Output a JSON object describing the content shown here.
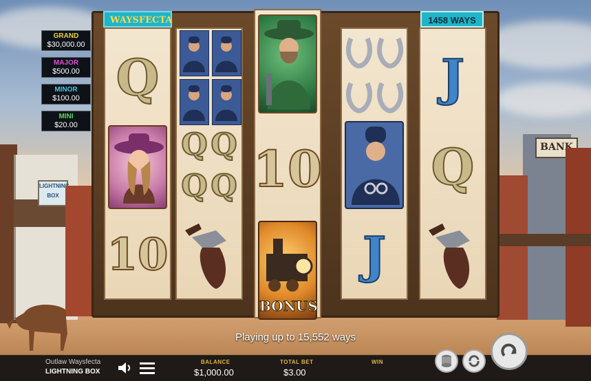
{
  "game": {
    "name": "Outlaw Waysfecta",
    "brand": "LIGHTNING BOX",
    "logo_text": "WAYSFECTA",
    "ways_badge": "1458 WAYS"
  },
  "jackpots": [
    {
      "label": "GRAND",
      "value": "$30,000.00",
      "color": "#f2d23a"
    },
    {
      "label": "MAJOR",
      "value": "$500.00",
      "color": "#e04fd0"
    },
    {
      "label": "MINOR",
      "value": "$100.00",
      "color": "#43c7e8"
    },
    {
      "label": "MINI",
      "value": "$20.00",
      "color": "#57d957"
    }
  ],
  "reels": [
    {
      "symbols": [
        "Q",
        "cowgirl",
        "10"
      ]
    },
    {
      "symbols": [
        "policeman x4",
        "Q x4",
        "revolver"
      ]
    },
    {
      "symbols": [
        "outlaw",
        "10",
        "train bonus"
      ]
    },
    {
      "symbols": [
        "horseshoe x4",
        "policeman",
        "J"
      ]
    },
    {
      "symbols": [
        "J",
        "Q",
        "revolver"
      ]
    }
  ],
  "bonus_label": "BONUS",
  "message": "Playing up to 15,552 ways",
  "bottom_bar": {
    "balance_label": "BALANCE",
    "balance_value": "$1,000.00",
    "bet_label": "TOTAL BET",
    "bet_value": "$3.00",
    "win_label": "WIN",
    "win_value": ""
  },
  "icons": [
    "speaker-icon",
    "menu-icon",
    "coin-stack-icon",
    "autoplay-icon",
    "spin-icon"
  ],
  "sign_text": "BANK",
  "shop_sign": "LIGHTNING BOX"
}
